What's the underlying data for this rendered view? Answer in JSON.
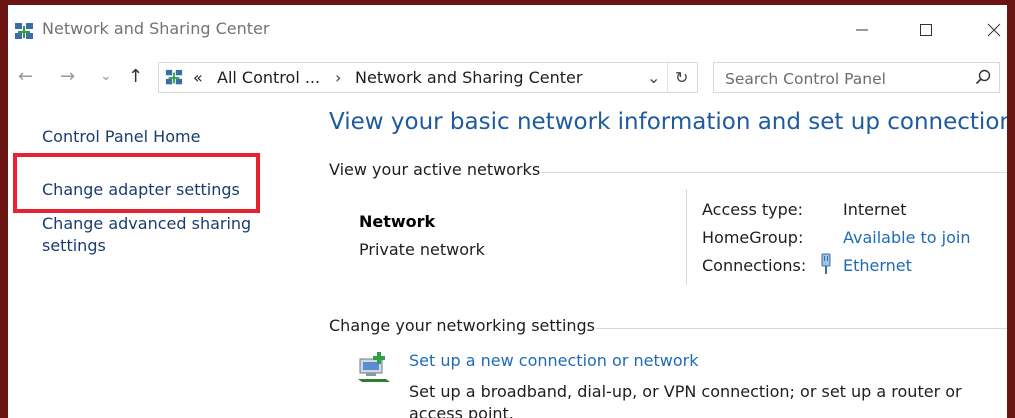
{
  "window": {
    "title": "Network and Sharing Center",
    "controls": {
      "minimize": "minimize",
      "maximize": "maximize",
      "close": "close"
    }
  },
  "nav": {
    "back": "←",
    "forward": "→",
    "recent": "⌄",
    "up": "↑",
    "breadcrumb_overflow": "«",
    "crumbs": [
      "All Control ...",
      "Network and Sharing Center"
    ],
    "crumb_sep": "›",
    "dropdown": "⌄",
    "refresh": "↻",
    "search_placeholder": "Search Control Panel"
  },
  "left_pane": {
    "links": [
      "Control Panel Home",
      "Change adapter settings",
      "Change advanced sharing settings"
    ],
    "highlighted_link": "Change adapter settings",
    "highlight_color": "#e8232f"
  },
  "main": {
    "title": "View your basic network information and set up connections",
    "active_networks": {
      "heading": "View your active networks",
      "network_name": "Network",
      "network_type": "Private network",
      "properties": [
        {
          "label": "Access type:",
          "value": "Internet"
        },
        {
          "label": "HomeGroup:",
          "value": "Available to join"
        },
        {
          "label": "Connections:",
          "value": "Ethernet"
        }
      ]
    },
    "change_settings": {
      "heading": "Change your networking settings",
      "tasks": [
        {
          "link": "Set up a new connection or network",
          "description": "Set up a broadband, dial-up, or VPN connection; or set up a router or access point."
        }
      ]
    }
  },
  "icons": {
    "app": "network-center-icon",
    "connection": "ethernet-icon",
    "task": "new-connection-icon"
  },
  "colors": {
    "link": "#1e6bb8",
    "title": "#1e5a9d",
    "left_link": "#1a3d6e",
    "frame": "#6b1414"
  }
}
